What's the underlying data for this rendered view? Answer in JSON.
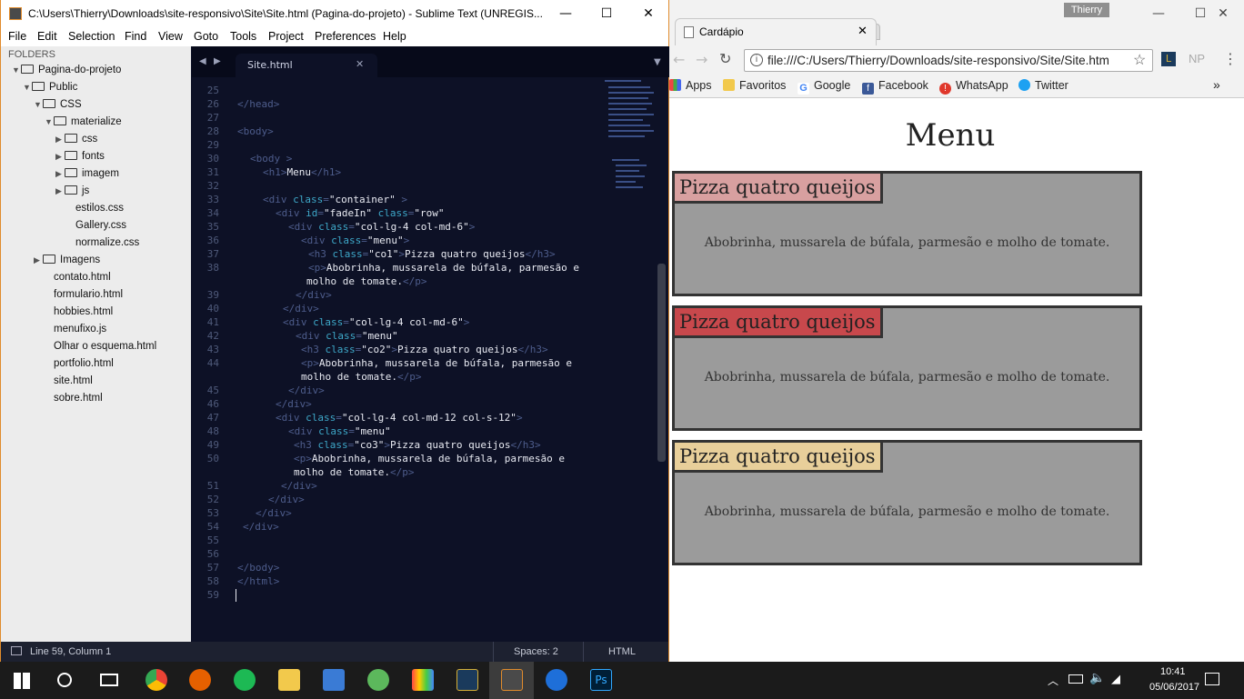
{
  "sublime": {
    "title": "C:\\Users\\Thierry\\Downloads\\site-responsivo\\Site\\Site.html (Pagina-do-projeto) - Sublime Text (UNREGIS...",
    "menu": [
      "File",
      "Edit",
      "Selection",
      "Find",
      "View",
      "Goto",
      "Tools",
      "Project",
      "Preferences",
      "Help"
    ],
    "sidebar": {
      "header": "FOLDERS",
      "items": [
        "Pagina-do-projeto",
        "Public",
        "CSS",
        "materialize",
        "css",
        "fonts",
        "imagem",
        "js",
        "estilos.css",
        "Gallery.css",
        "normalize.css",
        "Imagens",
        "contato.html",
        "formulario.html",
        "hobbies.html",
        "menufixo.js",
        "Olhar o esquema.html",
        "portfolio.html",
        "site.html",
        "sobre.html"
      ]
    },
    "tab": "Site.html",
    "line_numbers": [
      "25",
      "26",
      "27",
      "28",
      "29",
      "30",
      "31",
      "32",
      "33",
      "34",
      "35",
      "36",
      "37",
      "38",
      "",
      "39",
      "40",
      "41",
      "42",
      "43",
      "44",
      "",
      "45",
      "46",
      "47",
      "48",
      "49",
      "50",
      "",
      "51",
      "52",
      "53",
      "54",
      "55",
      "56",
      "57",
      "58",
      "59"
    ],
    "code": {
      "l26": "</head>",
      "l28": "<body>",
      "l30a": "<body ",
      "l30b": ">",
      "l31a": "<h1>",
      "l31b": "Menu",
      "l31c": "</h1>",
      "l33a": "<div ",
      "l33b": "class",
      "l33c": "=",
      "l33d": "\"container\"",
      "l33e": " >",
      "l34a": "<div ",
      "l34b": "id",
      "l34c": "=",
      "l34d": "\"fadeIn\"",
      "l34e": " class",
      "l34f": "=",
      "l34g": "\"row\"",
      "l35a": "<div ",
      "l35b": "class",
      "l35c": "=",
      "l35d": "\"col-lg-4 col-md-6\"",
      "l35e": ">",
      "l36a": "<div ",
      "l36b": "class",
      "l36c": "=",
      "l36d": "\"menu\"",
      "l36e": ">",
      "l37a": "<h3 ",
      "l37b": "class",
      "l37c": "=",
      "l37d": "\"co1\"",
      "l37e": ">",
      "l37f": "Pizza quatro queijos",
      "l37g": "</h3>",
      "l38a": "<p>",
      "l38b": "Abobrinha, mussarela de búfala, parmesão e",
      "l38c": "molho de tomate.",
      "l38d": "</p>",
      "l39": "</div>",
      "l40": "</div>",
      "l41a": "<div ",
      "l41b": "class",
      "l41c": "=",
      "l41d": "\"col-lg-4 col-md-6\"",
      "l41e": ">",
      "l42a": "<div ",
      "l42b": "class",
      "l42c": "=",
      "l42d": "\"menu\"",
      "l43a": "<h3 ",
      "l43b": "class",
      "l43c": "=",
      "l43d": "\"co2\"",
      "l43e": ">",
      "l43f": "Pizza quatro queijos",
      "l43g": "</h3>",
      "l44a": "<p>",
      "l44b": "Abobrinha, mussarela de búfala, parmesão e",
      "l44c": "molho de tomate.",
      "l44d": "</p>",
      "l45": "</div>",
      "l46": "</div>",
      "l47a": "<div ",
      "l47b": "class",
      "l47c": "=",
      "l47d": "\"col-lg-4 col-md-12 col-s-12\"",
      "l47e": ">",
      "l48a": "<div ",
      "l48b": "class",
      "l48c": "=",
      "l48d": "\"menu\"",
      "l49a": "<h3 ",
      "l49b": "class",
      "l49c": "=",
      "l49d": "\"co3\"",
      "l49e": ">",
      "l49f": "Pizza quatro queijos",
      "l49g": "</h3>",
      "l50a": "<p>",
      "l50b": "Abobrinha, mussarela de búfala, parmesão e",
      "l50c": "molho de tomate.",
      "l50d": "</p>",
      "l51": "</div>",
      "l52": "</div>",
      "l53": "</div>",
      "l54": "</div>",
      "l57": "</body>",
      "l58": "</html>"
    },
    "status": {
      "position": "Line 59, Column 1",
      "spaces": "Spaces: 2",
      "syntax": "HTML"
    }
  },
  "chrome": {
    "user": "Thierry",
    "tab_title": "Cardápio",
    "url": "file:///C:/Users/Thierry/Downloads/site-responsivo/Site/Site.htm",
    "ext_np": "NP",
    "bookmarks": [
      "Apps",
      "Favoritos",
      "Google",
      "Facebook",
      "WhatsApp",
      "Twitter"
    ],
    "page": {
      "heading": "Menu",
      "cards": [
        {
          "title": "Pizza quatro queijos",
          "text": "Abobrinha, mussarela de búfala, parmesão e molho de tomate.",
          "color": "#d8a0a0"
        },
        {
          "title": "Pizza quatro queijos",
          "text": "Abobrinha, mussarela de búfala, parmesão e molho de tomate.",
          "color": "#c8484c"
        },
        {
          "title": "Pizza quatro queijos",
          "text": "Abobrinha, mussarela de búfala, parmesão e molho de tomate.",
          "color": "#e8cf9a"
        }
      ]
    }
  },
  "taskbar": {
    "time": "10:41",
    "date": "05/06/2017"
  },
  "colors": {
    "sublime_bg": "#0d1126",
    "sublime_accent": "#e08b2c",
    "card_bg": "#9b9b9b"
  }
}
